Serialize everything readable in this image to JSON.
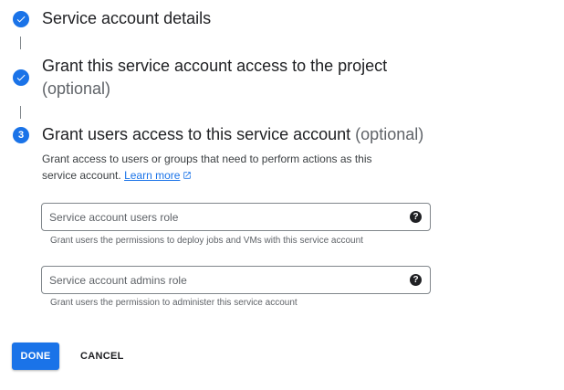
{
  "steps": [
    {
      "status": "complete",
      "icon": "check-icon",
      "title": "Service account details"
    },
    {
      "status": "complete",
      "icon": "check-icon",
      "title": "Grant this service account access to the project",
      "optional": "(optional)"
    },
    {
      "status": "current",
      "number": "3",
      "title": "Grant users access to this service account",
      "optional": "(optional)"
    }
  ],
  "description": {
    "text": "Grant access to users or groups that need to perform actions as this service account.",
    "link": "Learn more"
  },
  "fields": [
    {
      "placeholder": "Service account users role",
      "hint": "Grant users the permissions to deploy jobs and VMs with this service account",
      "help_icon": "help-icon"
    },
    {
      "placeholder": "Service account admins role",
      "hint": "Grant users the permission to administer this service account",
      "help_icon": "help-icon"
    }
  ],
  "buttons": {
    "done": "DONE",
    "cancel": "CANCEL"
  },
  "colors": {
    "accent": "#1a73e8",
    "text": "#202124",
    "secondary_text": "#5f6368"
  }
}
